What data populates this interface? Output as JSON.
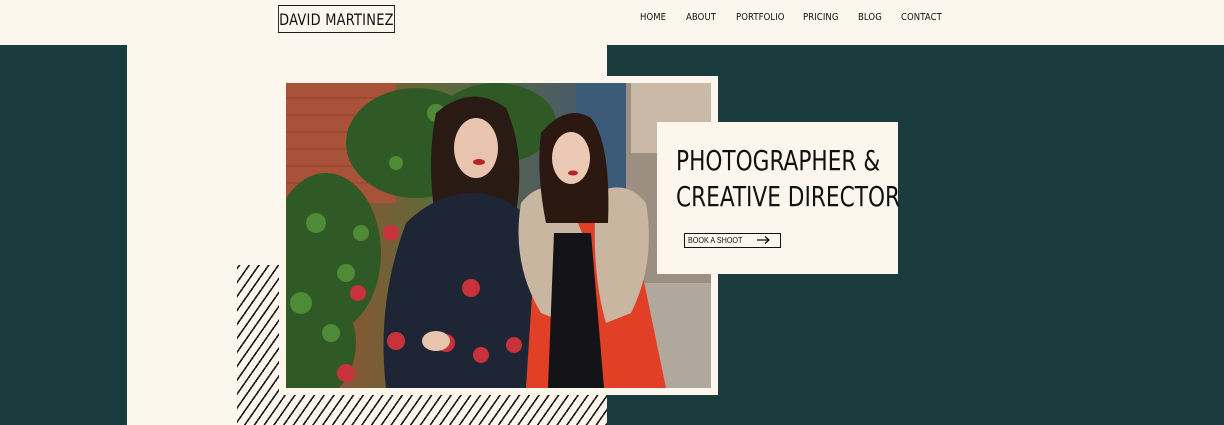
{
  "brand": {
    "name": "DAVID MARTINEZ"
  },
  "nav": {
    "items": [
      "HOME",
      "ABOUT",
      "PORTFOLIO",
      "PRICING",
      "BLOG",
      "CONTACT"
    ]
  },
  "hero": {
    "headline_line1": "PHOTOGRAPHER &",
    "headline_line2": "CREATIVE DIRECTOR",
    "cta_label": "BOOK A SHOOT"
  },
  "colors": {
    "background": "#fdf6ec",
    "accent_dark": "#1a3c3e",
    "text": "#111111"
  },
  "icons": {
    "cta": "arrow-right-icon"
  }
}
